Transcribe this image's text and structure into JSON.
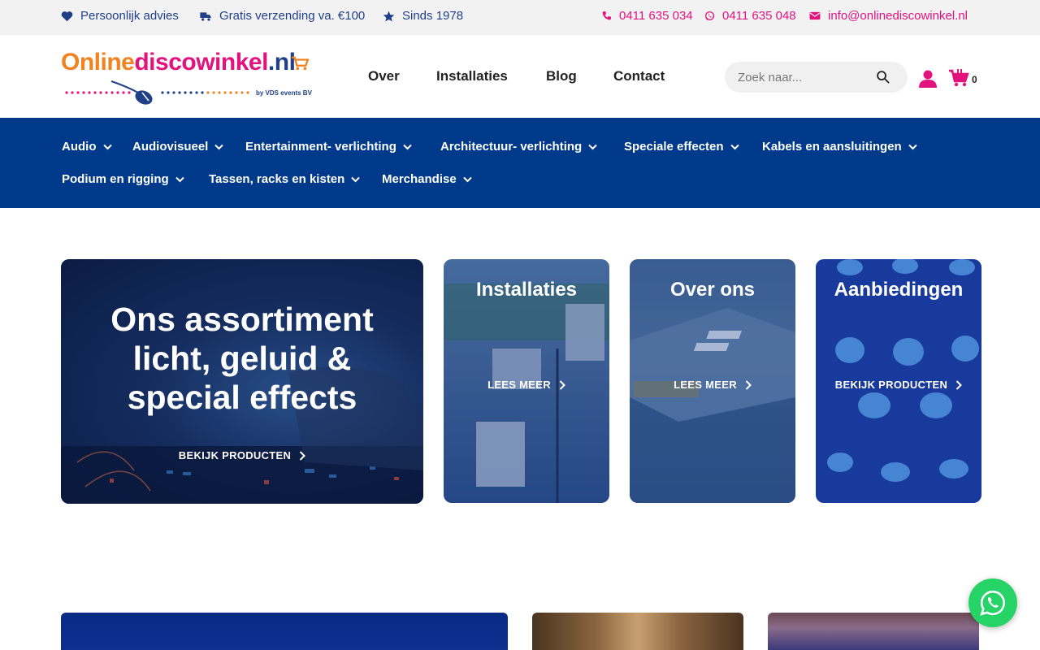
{
  "topbar": {
    "items_left": [
      {
        "icon": "heart-icon",
        "label": "Persoonlijk advies"
      },
      {
        "icon": "truck-icon",
        "label": "Gratis verzending va. €100"
      },
      {
        "icon": "star-icon",
        "label": "Sinds 1978"
      }
    ],
    "items_right": [
      {
        "icon": "phone-icon",
        "label": "0411 635 034"
      },
      {
        "icon": "whatsapp-icon",
        "label": "0411 635 048"
      },
      {
        "icon": "mail-icon",
        "label": "info@onlinediscowinkel.nl"
      }
    ]
  },
  "logo": {
    "part1": "Online",
    "part2": "discowinkel",
    "part3": ".nl",
    "sub": "by VDS events BV"
  },
  "mainnav": [
    "Over",
    "Installaties",
    "Blog",
    "Contact"
  ],
  "search": {
    "placeholder": "Zoek naar..."
  },
  "cart": {
    "count": "0"
  },
  "categories": [
    "Audio",
    "Audiovisueel",
    "Entertainment- verlichting",
    "Architectuur- verlichting",
    "Speciale effecten",
    "Kabels en aansluitingen",
    "Podium en rigging",
    "Tassen, racks en kisten",
    "Merchandise"
  ],
  "hero_cards": [
    {
      "title": "Ons assortiment licht, geluid & special effects",
      "link": "BEKIJK PRODUCTEN"
    },
    {
      "title": "Installaties",
      "link": "LEES MEER"
    },
    {
      "title": "Over ons",
      "link": "LEES MEER"
    },
    {
      "title": "Aanbiedingen",
      "link": "BEKIJK PRODUCTEN"
    }
  ],
  "colors": {
    "brand_blue": "#013a8b",
    "brand_pink": "#e2137d",
    "brand_orange": "#f08220",
    "whatsapp_green": "#25d366"
  }
}
